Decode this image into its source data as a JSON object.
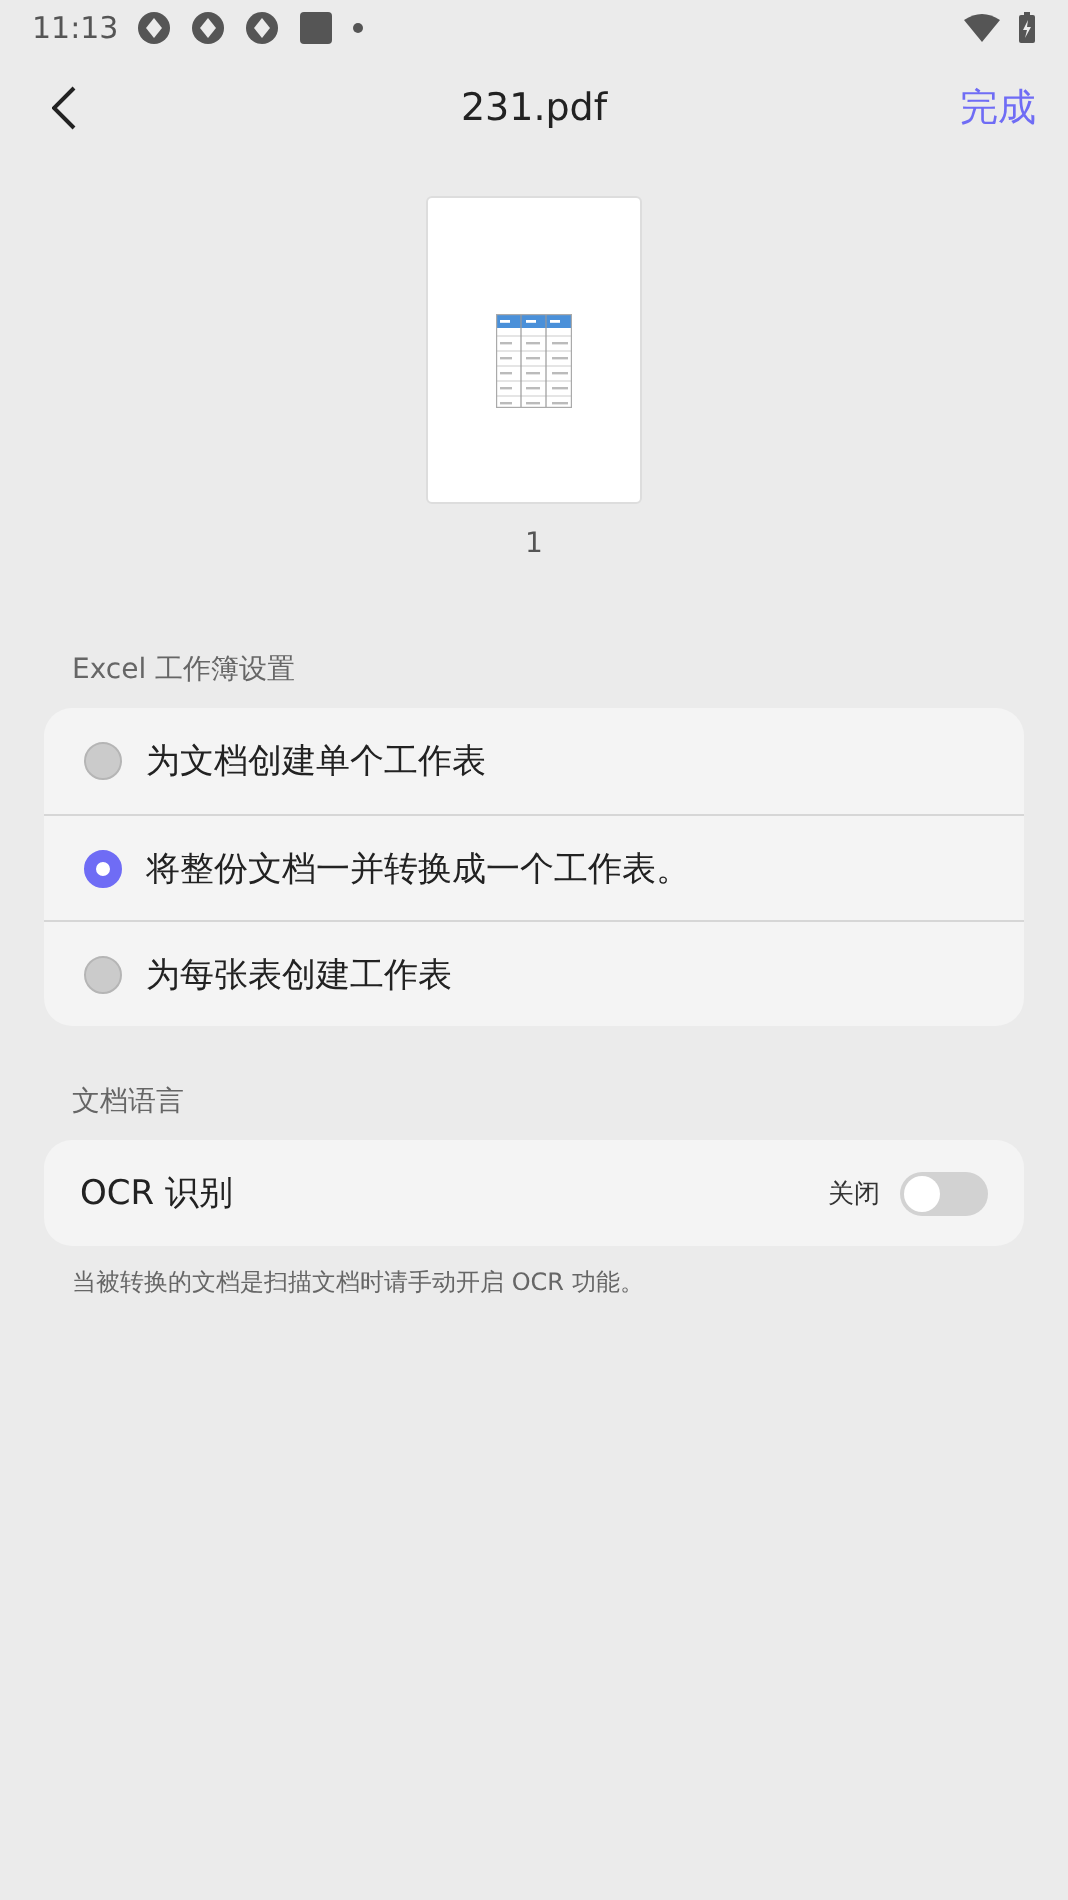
{
  "status_bar": {
    "time": "11:13"
  },
  "header": {
    "title": "231.pdf",
    "done": "完成"
  },
  "preview": {
    "page_number": "1"
  },
  "workbook_section": {
    "label": "Excel 工作簿设置",
    "options": [
      {
        "label": "为文档创建单个工作表",
        "selected": false
      },
      {
        "label": "将整份文档一并转换成一个工作表。",
        "selected": true
      },
      {
        "label": "为每张表创建工作表",
        "selected": false
      }
    ]
  },
  "language_section": {
    "label": "文档语言",
    "ocr": {
      "label": "OCR 识别",
      "state_text": "关闭",
      "on": false
    },
    "hint": "当被转换的文档是扫描文档时请手动开启 OCR 功能。"
  }
}
